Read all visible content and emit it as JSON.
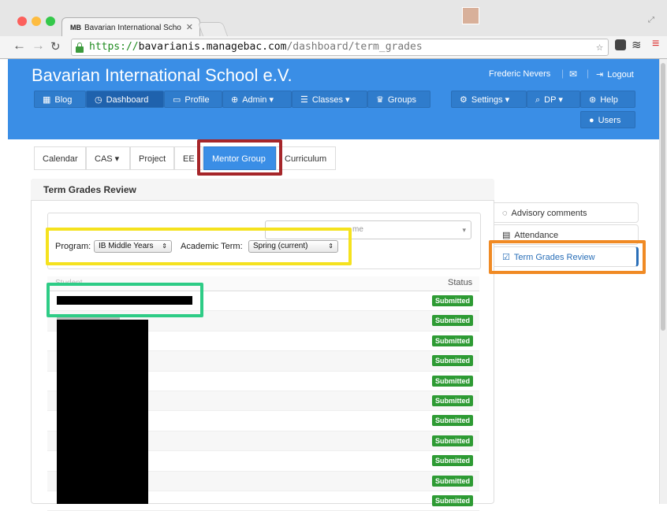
{
  "browser": {
    "tab_title": "Bavarian International Scho",
    "tab_favicon": "MB",
    "url_scheme": "https://",
    "url_domain": "bavarianis.managebac.com",
    "url_path": "/dashboard/term_grades",
    "traffic_lights": [
      "#fc605c",
      "#fdbc40",
      "#34c84a"
    ]
  },
  "header": {
    "school_name": "Bavarian International School e.V.",
    "user_name": "Frederic Nevers",
    "logout_label": "Logout",
    "nav": [
      {
        "label": "Blog",
        "icon": "grid-icon"
      },
      {
        "label": "Dashboard",
        "icon": "dashboard-icon"
      },
      {
        "label": "Profile",
        "icon": "id-card-icon"
      },
      {
        "label": "Admin",
        "icon": "globe-icon"
      },
      {
        "label": "Classes",
        "icon": "list-icon"
      },
      {
        "label": "Groups",
        "icon": "trophy-icon"
      }
    ],
    "right_nav": [
      {
        "label": "Settings",
        "icon": "gear-icon"
      },
      {
        "label": "DP",
        "icon": "search-icon"
      },
      {
        "label": "Help",
        "icon": "lifebuoy-icon"
      },
      {
        "label": "Users",
        "icon": "user-icon"
      }
    ]
  },
  "subtabs": [
    "Calendar",
    "CAS",
    "Project",
    "EE",
    "Mentor Group",
    "Curriculum"
  ],
  "panel": {
    "title": "Term Grades Review",
    "search_placeholder": "me",
    "program_label": "Program:",
    "program_value": "IB Middle Years",
    "term_label": "Academic Term:",
    "term_value": "Spring (current)",
    "col_student": "Student",
    "col_status": "Status",
    "statuses": [
      "Submitted",
      "Submitted",
      "Submitted",
      "Submitted",
      "Submitted",
      "Submitted",
      "Submitted",
      "Submitted",
      "Submitted",
      "Submitted",
      "Submitted"
    ]
  },
  "side_tabs": [
    {
      "label": "Advisory comments",
      "icon": "comment-icon"
    },
    {
      "label": "Attendance",
      "icon": "calendar-icon"
    },
    {
      "label": "Term Grades Review",
      "icon": "checkbox-icon"
    }
  ],
  "colors": {
    "header_blue": "#3a8ee6",
    "submitted_green": "#2e9b34",
    "highlight_red": "#a6262a",
    "highlight_yellow": "#f5e21e",
    "highlight_teal": "#2ecc86",
    "highlight_orange": "#f08a24"
  }
}
